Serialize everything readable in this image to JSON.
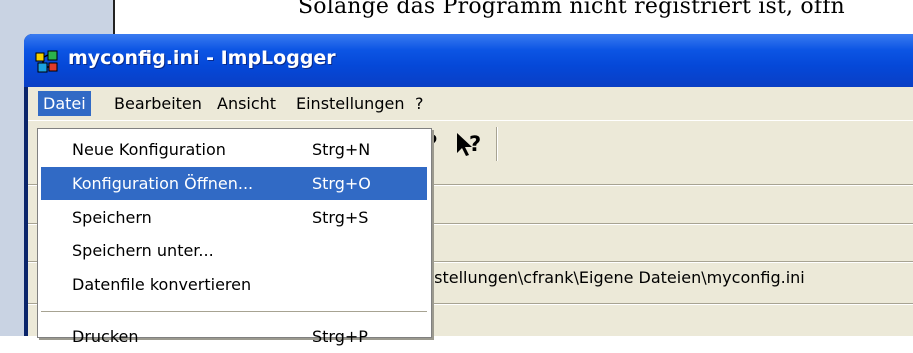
{
  "background": {
    "document_text": "Solange das Programm nicht registriert ist, öffn"
  },
  "window": {
    "title": "myconfig.ini - ImpLogger",
    "menubar": [
      {
        "label": "Datei"
      },
      {
        "label": "Bearbeiten"
      },
      {
        "label": "Ansicht"
      },
      {
        "label": "Einstellungen"
      },
      {
        "label": "?"
      }
    ],
    "toolbar": {
      "help_label": "?",
      "whats_this_label": "?"
    },
    "path_text": "nstellungen\\cfrank\\Eigene Dateien\\myconfig.ini"
  },
  "datei_menu": {
    "items": [
      {
        "label": "Neue Konfiguration",
        "shortcut": "Strg+N"
      },
      {
        "label": "Konfiguration Öffnen...",
        "shortcut": "Strg+O"
      },
      {
        "label": "Speichern",
        "shortcut": "Strg+S"
      },
      {
        "label": "Speichern unter...",
        "shortcut": ""
      },
      {
        "label": "Datenfile konvertieren",
        "shortcut": ""
      },
      {
        "label": "Drucken",
        "shortcut": "Strg+P"
      }
    ]
  },
  "colors": {
    "titlebar": "#0c55e4",
    "menu_highlight": "#316ac5",
    "face": "#ece9d8"
  }
}
